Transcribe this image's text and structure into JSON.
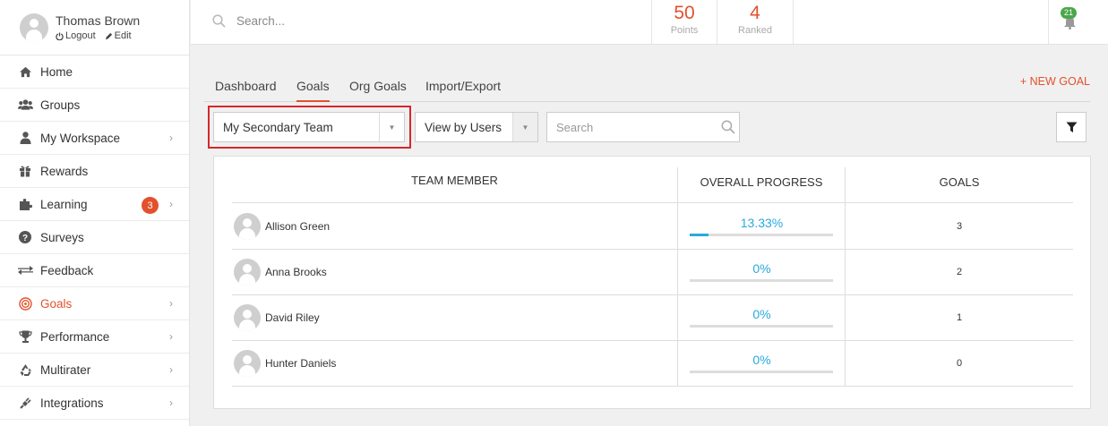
{
  "profile": {
    "name": "Thomas Brown",
    "logout": "Logout",
    "edit": "Edit"
  },
  "sidebar": {
    "items": [
      {
        "label": "Home",
        "icon": "home-icon"
      },
      {
        "label": "Groups",
        "icon": "users-icon"
      },
      {
        "label": "My Workspace",
        "icon": "user-icon"
      },
      {
        "label": "Rewards",
        "icon": "gift-icon"
      },
      {
        "label": "Learning",
        "icon": "puzzle-icon",
        "badge": "3"
      },
      {
        "label": "Surveys",
        "icon": "question-icon"
      },
      {
        "label": "Feedback",
        "icon": "exchange-icon"
      },
      {
        "label": "Goals",
        "icon": "target-icon",
        "active": true
      },
      {
        "label": "Performance",
        "icon": "trophy-icon"
      },
      {
        "label": "Multirater",
        "icon": "recycle-icon"
      },
      {
        "label": "Integrations",
        "icon": "plug-icon"
      }
    ]
  },
  "topbar": {
    "search_placeholder": "Search...",
    "points_value": "50",
    "points_label": "Points",
    "ranked_value": "4",
    "ranked_label": "Ranked",
    "notification_count": "21"
  },
  "tabs": [
    {
      "label": "Dashboard"
    },
    {
      "label": "Goals",
      "active": true
    },
    {
      "label": "Org Goals"
    },
    {
      "label": "Import/Export"
    }
  ],
  "new_goal_label": "+ NEW GOAL",
  "filters": {
    "team_selected": "My Secondary Team",
    "view_selected": "View by Users",
    "search_placeholder": "Search"
  },
  "table": {
    "headers": {
      "member": "TEAM MEMBER",
      "progress": "OVERALL PROGRESS",
      "goals": "GOALS"
    },
    "rows": [
      {
        "name": "Allison Green",
        "progress_text": "13.33%",
        "progress": 0.1333,
        "goals": "3"
      },
      {
        "name": "Anna Brooks",
        "progress_text": "0%",
        "progress": 0,
        "goals": "2"
      },
      {
        "name": "David Riley",
        "progress_text": "0%",
        "progress": 0,
        "goals": "1"
      },
      {
        "name": "Hunter Daniels",
        "progress_text": "0%",
        "progress": 0,
        "goals": "0"
      }
    ]
  },
  "colors": {
    "accent": "#e2512b",
    "progress": "#29a9e0",
    "highlight": "#d9262c",
    "notification": "#4aa84a"
  }
}
